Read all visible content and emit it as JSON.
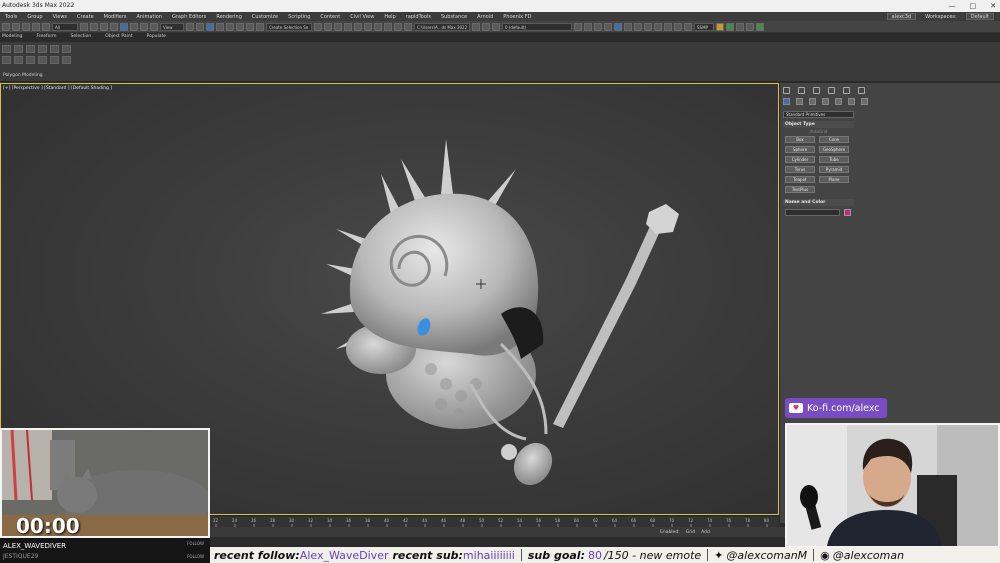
{
  "window": {
    "title": "Autodesk 3ds Max 2022"
  },
  "menu": {
    "items": [
      "Tools",
      "Group",
      "Views",
      "Create",
      "Modifiers",
      "Animation",
      "Graph Editors",
      "Rendering",
      "Customize",
      "Scripting",
      "Content",
      "Civil View",
      "Help",
      "rapidTools",
      "Substance",
      "Arnold",
      "Phoenix FD"
    ],
    "user": "alexc3d",
    "workspace_label": "Workspaces:",
    "workspace_value": "Default"
  },
  "toolbar": {
    "view_dropdown": "View",
    "selection_set": "Create Selection Se",
    "path_field": "C:\\Users\\A...ds Max 2022",
    "layer_field": "0 (default)",
    "smp": "SSMP"
  },
  "ribbon": {
    "tabs": [
      "Modeling",
      "Freeform",
      "Selection",
      "Object Paint",
      "Populate"
    ],
    "panel_label": "Polygon Modeling"
  },
  "viewport": {
    "label": "[+] [Perspective ] [Standard ] [Default Shading ]"
  },
  "command_panel": {
    "category": "Standard Primitives",
    "object_type_header": "Object Type",
    "autogrid": "AutoGrid",
    "primitives": [
      "Box",
      "Cone",
      "Sphere",
      "GeoSphere",
      "Cylinder",
      "Tube",
      "Torus",
      "Pyramid",
      "Teapot",
      "Plane",
      "TextPlus"
    ],
    "name_color_header": "Name and Color",
    "color": "#c0307a"
  },
  "timeline": {
    "ticks": [
      "22",
      "24",
      "26",
      "28",
      "30",
      "32",
      "34",
      "36",
      "38",
      "40",
      "42",
      "44",
      "46",
      "48",
      "50",
      "52",
      "54",
      "56",
      "58",
      "60",
      "62",
      "64",
      "66",
      "68",
      "70",
      "72",
      "74",
      "76",
      "78",
      "80"
    ]
  },
  "status": {
    "enabled": "Enabled:",
    "grid": "Grid",
    "add": "Add"
  },
  "stream": {
    "timer": "00:00",
    "follower": "ALEX_WAVEDIVER",
    "follower_sub": "JESTIQUE29",
    "follow_tag": "FOLLOW",
    "kofi": "Ko-fi.com/alexc",
    "recent_follow_label": "recent follow:",
    "recent_follow": "Alex_WaveDiver",
    "recent_sub_label": "recent sub:",
    "recent_sub": "mihaiiiiiiii",
    "sub_goal_label": "sub goal:",
    "sub_goal_current": "80",
    "sub_goal_rest": "/150 - new emote",
    "twitter": "@alexcomanM",
    "instagram": "@alexcoman"
  }
}
